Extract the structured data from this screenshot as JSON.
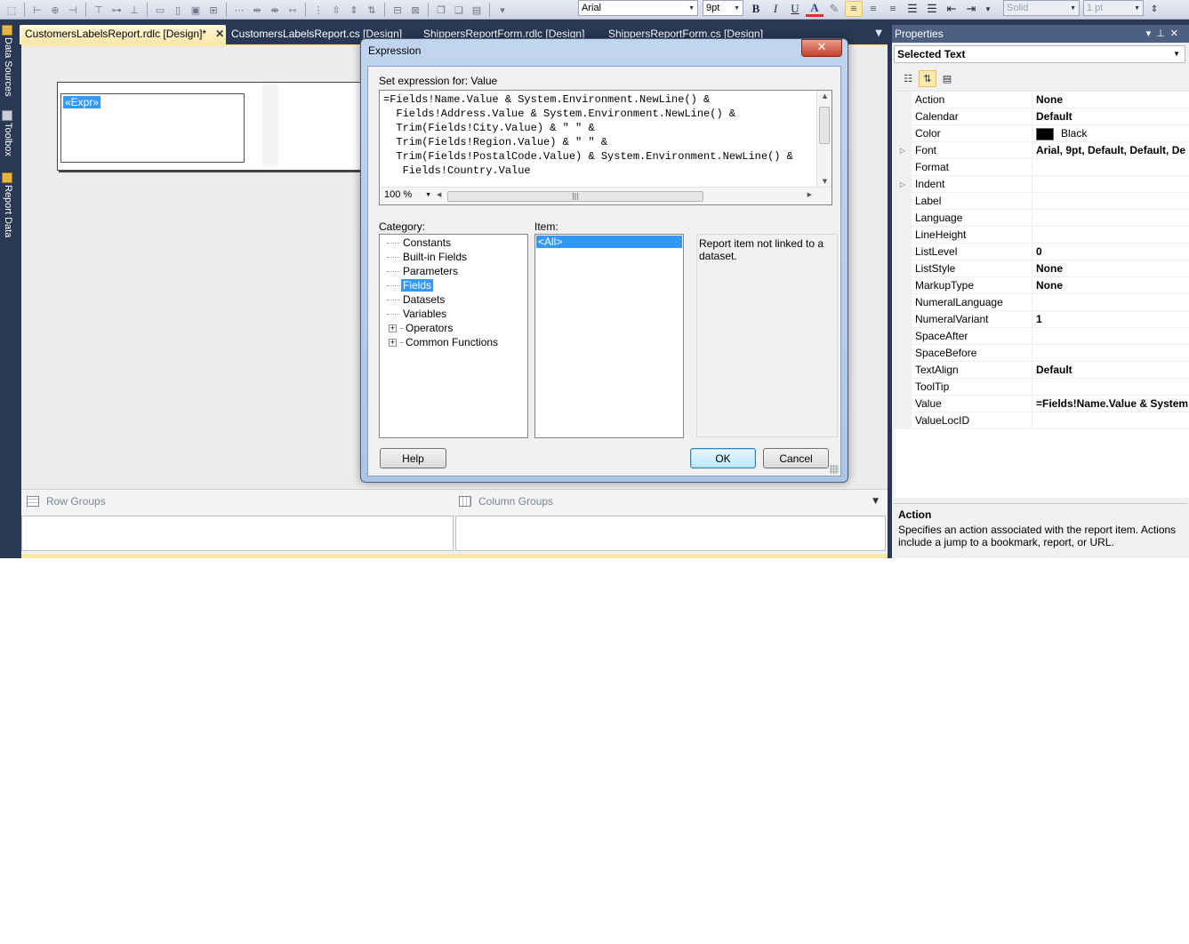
{
  "toolbar": {
    "font_name": "Arial",
    "font_size": "9pt",
    "bold_label": "B",
    "italic_label": "I",
    "underline_label": "U",
    "font_color_label": "A",
    "border_style": "Solid",
    "border_width": "1 pt"
  },
  "side_tabs": {
    "data_sources": "Data Sources",
    "toolbox": "Toolbox",
    "report_data": "Report Data"
  },
  "doc_tabs": [
    {
      "label": "CustomersLabelsReport.rdlc [Design]*",
      "active": true
    },
    {
      "label": "CustomersLabelsReport.cs [Design]",
      "active": false
    },
    {
      "label": "ShippersReportForm.rdlc [Design]",
      "active": false
    },
    {
      "label": "ShippersReportForm.cs [Design]",
      "active": false
    }
  ],
  "design": {
    "expr_placeholder": "«Expr»"
  },
  "groups": {
    "row_groups": "Row Groups",
    "column_groups": "Column Groups"
  },
  "properties": {
    "title": "Properties",
    "selected_object": "Selected Text",
    "rows": [
      {
        "name": "Action",
        "value": "None"
      },
      {
        "name": "Calendar",
        "value": "Default"
      },
      {
        "name": "Color",
        "value": "Black",
        "swatch": "#000000"
      },
      {
        "name": "Font",
        "value": "Arial, 9pt, Default, Default, De",
        "expandable": true
      },
      {
        "name": "Format",
        "value": ""
      },
      {
        "name": "Indent",
        "value": "",
        "expandable": true
      },
      {
        "name": "Label",
        "value": ""
      },
      {
        "name": "Language",
        "value": ""
      },
      {
        "name": "LineHeight",
        "value": ""
      },
      {
        "name": "ListLevel",
        "value": "0"
      },
      {
        "name": "ListStyle",
        "value": "None"
      },
      {
        "name": "MarkupType",
        "value": "None"
      },
      {
        "name": "NumeralLanguage",
        "value": ""
      },
      {
        "name": "NumeralVariant",
        "value": "1"
      },
      {
        "name": "SpaceAfter",
        "value": ""
      },
      {
        "name": "SpaceBefore",
        "value": ""
      },
      {
        "name": "TextAlign",
        "value": "Default"
      },
      {
        "name": "ToolTip",
        "value": ""
      },
      {
        "name": "Value",
        "value": "=Fields!Name.Value & System."
      },
      {
        "name": "ValueLocID",
        "value": ""
      }
    ],
    "description_title": "Action",
    "description_text": "Specifies an action associated with the report item. Actions include a jump to a bookmark, report, or URL."
  },
  "dialog": {
    "title": "Expression",
    "close_label": "✕",
    "set_expression_label": "Set expression for: Value",
    "expression": "=Fields!Name.Value & System.Environment.NewLine() &\n  Fields!Address.Value & System.Environment.NewLine() &\n  Trim(Fields!City.Value) & \" \" &\n  Trim(Fields!Region.Value) & \" \" &\n  Trim(Fields!PostalCode.Value) & System.Environment.NewLine() &\n   Fields!Country.Value",
    "zoom": "100 %",
    "category_label": "Category:",
    "item_label": "Item:",
    "categories": [
      {
        "label": "Constants",
        "expandable": false,
        "selected": false
      },
      {
        "label": "Built-in Fields",
        "expandable": false,
        "selected": false
      },
      {
        "label": "Parameters",
        "expandable": false,
        "selected": false
      },
      {
        "label": "Fields",
        "expandable": false,
        "selected": true
      },
      {
        "label": "Datasets",
        "expandable": false,
        "selected": false
      },
      {
        "label": "Variables",
        "expandable": false,
        "selected": false
      },
      {
        "label": "Operators",
        "expandable": true,
        "selected": false
      },
      {
        "label": "Common Functions",
        "expandable": true,
        "selected": false
      }
    ],
    "selected_item": "<All>",
    "item_description": "Report item not linked to a dataset.",
    "help_button": "Help",
    "ok_button": "OK",
    "cancel_button": "Cancel"
  }
}
